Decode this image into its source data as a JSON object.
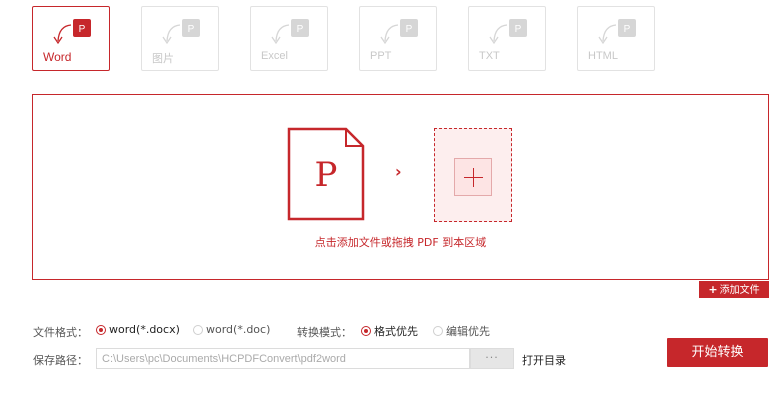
{
  "tabs": [
    {
      "label": "Word",
      "active": true
    },
    {
      "label": "图片",
      "active": false
    },
    {
      "label": "Excel",
      "active": false
    },
    {
      "label": "PPT",
      "active": false
    },
    {
      "label": "TXT",
      "active": false
    },
    {
      "label": "HTML",
      "active": false
    }
  ],
  "tab_badge_letter": "P",
  "dropzone": {
    "pdf_letter": "P",
    "arrow": "›",
    "hint": "点击添加文件或拖拽 PDF 到本区域"
  },
  "add_file_button": {
    "icon": "+",
    "label": "添加文件"
  },
  "options": {
    "format_label": "文件格式：",
    "format_options": [
      "word(*.docx)",
      "word(*.doc)"
    ],
    "format_selected": "word(*.docx)",
    "mode_label": "转换模式：",
    "mode_options": [
      "格式优先",
      "编辑优先"
    ],
    "mode_selected": "格式优先"
  },
  "save": {
    "label": "保存路径：",
    "path": "C:\\Users\\pc\\Documents\\HCPDFConvert\\pdf2word",
    "browse_label": "···",
    "open_dir_label": "打开目录"
  },
  "start_button_label": "开始转换",
  "colors": {
    "accent": "#c6272b",
    "inactive": "#d6d6d6"
  }
}
